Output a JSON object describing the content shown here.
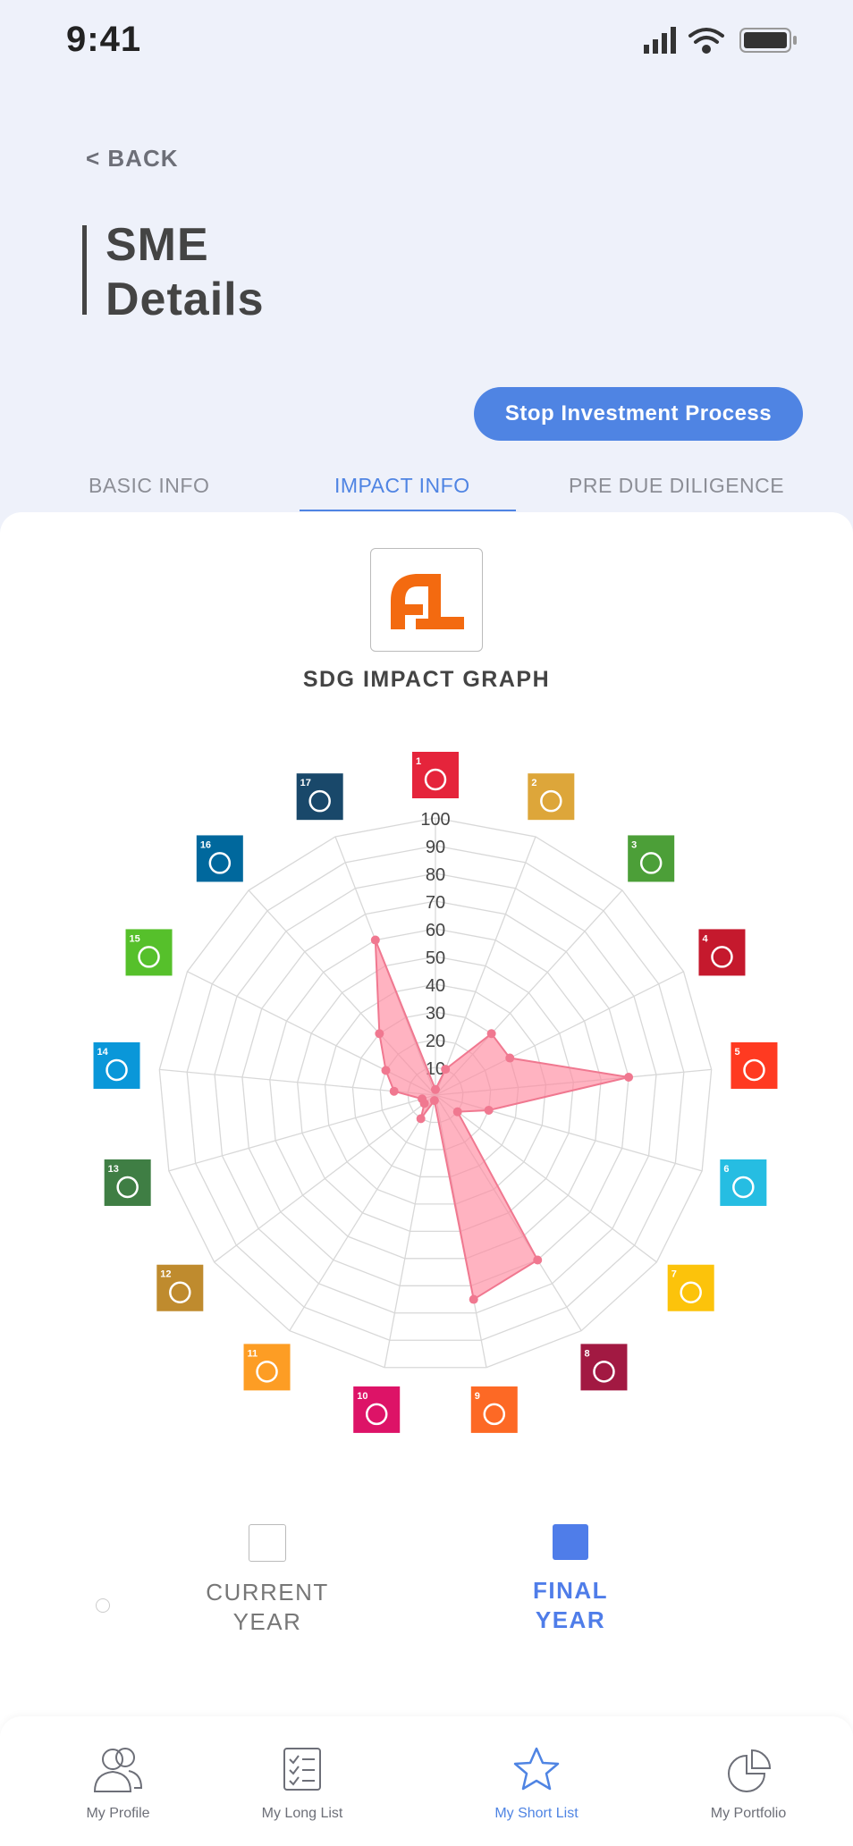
{
  "status": {
    "time": "9:41"
  },
  "nav_back": "< BACK",
  "page_title": "SME\nDetails",
  "stop_button": "Stop Investment Process",
  "tabs": [
    {
      "label": "BASIC INFO",
      "active": false
    },
    {
      "label": "IMPACT INFO",
      "active": true
    },
    {
      "label": "PRE DUE DILIGENCE",
      "active": false
    }
  ],
  "graph_title": "SDG IMPACT GRAPH",
  "chart_data": {
    "type": "radar",
    "scale": [
      10,
      20,
      30,
      40,
      50,
      60,
      70,
      80,
      90,
      100
    ],
    "categories": [
      "1",
      "2",
      "3",
      "4",
      "5",
      "6",
      "7",
      "8",
      "9",
      "10",
      "11",
      "12",
      "13",
      "14",
      "15",
      "16",
      "17"
    ],
    "category_colors": [
      "#e5243b",
      "#dda63a",
      "#4c9f38",
      "#c5192d",
      "#ff3a21",
      "#26bde2",
      "#fcc30b",
      "#a21942",
      "#fd6925",
      "#dd1367",
      "#fd9d24",
      "#bf8b2e",
      "#3f7e44",
      "#0a97d9",
      "#56c02b",
      "#00689d",
      "#19486a"
    ],
    "series": [
      {
        "values": [
          2,
          10,
          30,
          30,
          70,
          20,
          10,
          70,
          75,
          2,
          10,
          5,
          5,
          15,
          20,
          30,
          60
        ],
        "color": "#ff8aa0"
      }
    ]
  },
  "legend": [
    {
      "label": "CURRENT\nYEAR",
      "color": "#ffffff",
      "text_color": "#777777"
    },
    {
      "label": "FINAL\nYEAR",
      "color": "#4f7de9",
      "text_color": "#4f7de9"
    }
  ],
  "bottom_nav": [
    {
      "label": "My Profile",
      "icon": "profile-icon",
      "active": false
    },
    {
      "label": "My Long List",
      "icon": "list-icon",
      "active": false
    },
    {
      "label": "My Short List",
      "icon": "star-icon",
      "active": true
    },
    {
      "label": "My Portfolio",
      "icon": "pie-chart-icon",
      "active": false
    }
  ]
}
